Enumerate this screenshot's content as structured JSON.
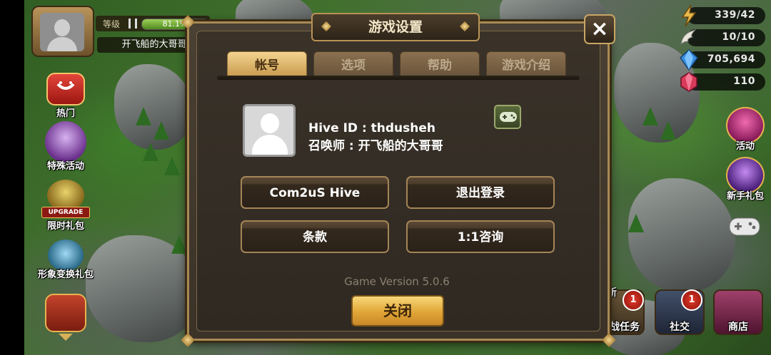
{
  "profile": {
    "level_label": "等级",
    "xp_percent_text": "81.1%",
    "xp_fraction": 0.811,
    "nickname": "开飞船的大哥哥"
  },
  "left_menu": [
    "热门",
    "特殊活动",
    "限时礼包",
    "形象变换礼包"
  ],
  "left_menu_upgrade": "UPGRADE",
  "resources": {
    "energy": "339/42",
    "wings": "10/10",
    "mana": "705,694",
    "crystal": "110"
  },
  "right_menu": [
    "活动",
    "新手礼包"
  ],
  "bottom_menu": {
    "quests": "挑战任务",
    "quests_badge": "1",
    "quests_new": "新",
    "social": "社交",
    "social_badge": "1",
    "shop": "商店"
  },
  "dialog": {
    "title": "游戏设置",
    "close_x": "×",
    "tabs": [
      "帐号",
      "选项",
      "帮助",
      "游戏介绍"
    ],
    "active_tab": 0,
    "hive_id": "Hive ID : thdusheh",
    "summoner": "召唤师 : 开飞船的大哥哥",
    "buttons": {
      "hive": "Com2uS Hive",
      "logout": "退出登录",
      "terms": "条款",
      "inquiry": "1:1咨询"
    },
    "version": "Game Version 5.0.6",
    "close_label": "关闭"
  },
  "colors": {
    "accent_gold": "#e0a536",
    "panel_border": "#a88a54",
    "tab_active": "#f3d48f"
  }
}
